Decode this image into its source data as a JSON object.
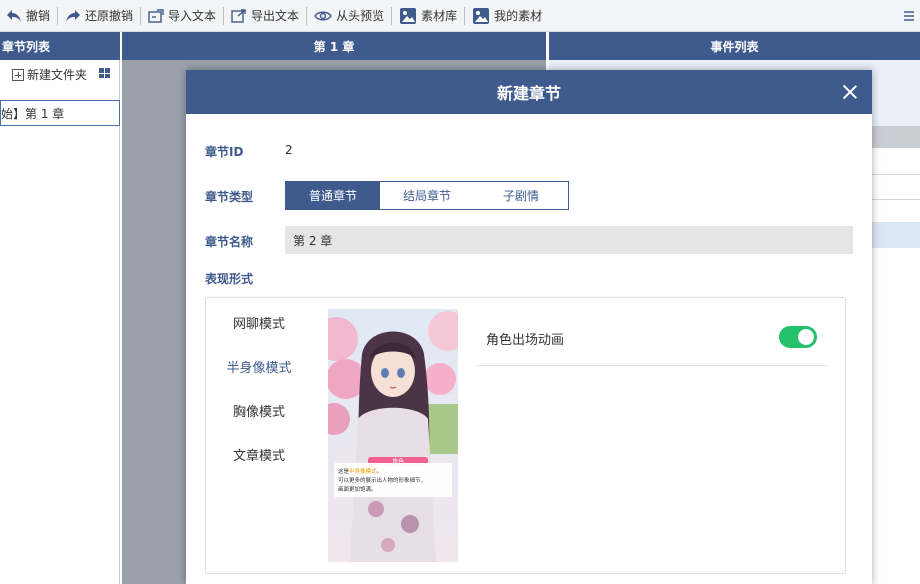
{
  "toolbar": {
    "undo": "撤销",
    "redo": "还原撤销",
    "import_text": "导入文本",
    "export_text": "导出文本",
    "preview_from_start": "从头预览",
    "asset_library": "素材库",
    "my_assets": "我的素材"
  },
  "panels": {
    "left_title": "章节列表",
    "middle_title": "第 1 章",
    "right_title": "事件列表"
  },
  "left": {
    "new_folder": "新建文件夹",
    "chapter_item": "始】第 1 章"
  },
  "modal": {
    "title": "新建章节",
    "id_label": "章节ID",
    "id_value": "2",
    "type_label": "章节类型",
    "types": [
      "普通章节",
      "结局章节",
      "子剧情"
    ],
    "selected_type": "普通章节",
    "name_label": "章节名称",
    "name_value": "第 2 章",
    "form_label": "表现形式",
    "modes": [
      "网聊模式",
      "半身像模式",
      "胸像模式",
      "文章模式"
    ],
    "selected_mode": "半身像模式",
    "toggle_label": "角色出场动画",
    "toggle_on": true,
    "preview": {
      "tag": "角色",
      "line1_prefix": "这是",
      "line1_highlight": "半身像模式",
      "line1_suffix": "。",
      "line2": "可以更多的展示出人物的形象细节，",
      "line3": "画面更加饱满。"
    }
  },
  "colors": {
    "header_bg": "#3f5b8d",
    "toggle_on": "#24c26a",
    "highlight_text": "#f0a000",
    "preview_tag": "#f06090"
  }
}
